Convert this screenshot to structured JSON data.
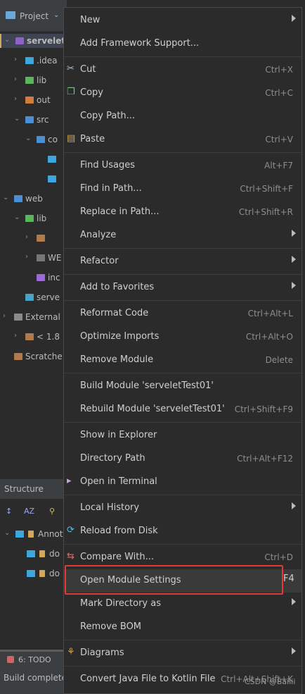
{
  "left_panel": {
    "title": "Project",
    "tree": [
      {
        "label": "servelet",
        "arrow": "▾",
        "bold": true
      },
      {
        "label": ".idea",
        "arrow": "›"
      },
      {
        "label": "lib",
        "arrow": "›"
      },
      {
        "label": "out",
        "arrow": "›"
      },
      {
        "label": "src",
        "arrow": "▾"
      },
      {
        "label": "co",
        "arrow": "▾"
      },
      {
        "label": "",
        "arrow": ""
      },
      {
        "label": "",
        "arrow": ""
      },
      {
        "label": "web",
        "arrow": "▾"
      },
      {
        "label": "lib",
        "arrow": "▾"
      },
      {
        "label": "",
        "arrow": "›"
      },
      {
        "label": "WE",
        "arrow": "›"
      },
      {
        "label": "inc",
        "arrow": ""
      },
      {
        "label": "serve",
        "arrow": ""
      },
      {
        "label": "External",
        "arrow": "›"
      },
      {
        "label": "< 1.8",
        "arrow": "›"
      },
      {
        "label": "Scratche",
        "arrow": ""
      }
    ],
    "structure_title": "Structure",
    "structure_items": [
      "Annot",
      "do",
      "do"
    ],
    "todo_label": "6: TODO",
    "status_text": "Build complete"
  },
  "context_menu": {
    "items": [
      {
        "label": "New",
        "submenu": true
      },
      {
        "label": "Add Framework Support..."
      },
      {
        "sep": true
      },
      {
        "label": "Cut",
        "shortcut": "Ctrl+X",
        "icon": "scissors-icon"
      },
      {
        "label": "Copy",
        "shortcut": "Ctrl+C",
        "icon": "copy-icon"
      },
      {
        "label": "Copy Path..."
      },
      {
        "label": "Paste",
        "shortcut": "Ctrl+V",
        "icon": "paste-icon"
      },
      {
        "sep": true
      },
      {
        "label": "Find Usages",
        "shortcut": "Alt+F7"
      },
      {
        "label": "Find in Path...",
        "shortcut": "Ctrl+Shift+F"
      },
      {
        "label": "Replace in Path...",
        "shortcut": "Ctrl+Shift+R"
      },
      {
        "label": "Analyze",
        "submenu": true
      },
      {
        "sep": true
      },
      {
        "label": "Refactor",
        "submenu": true
      },
      {
        "sep": true
      },
      {
        "label": "Add to Favorites",
        "submenu": true
      },
      {
        "sep": true
      },
      {
        "label": "Reformat Code",
        "shortcut": "Ctrl+Alt+L"
      },
      {
        "label": "Optimize Imports",
        "shortcut": "Ctrl+Alt+O"
      },
      {
        "label": "Remove Module",
        "shortcut": "Delete"
      },
      {
        "sep": true
      },
      {
        "label": "Build Module 'serveletTest01'"
      },
      {
        "label": "Rebuild Module 'serveletTest01'",
        "shortcut": "Ctrl+Shift+F9"
      },
      {
        "sep": true
      },
      {
        "label": "Show in Explorer"
      },
      {
        "label": "Directory Path",
        "shortcut": "Ctrl+Alt+F12"
      },
      {
        "label": "Open in Terminal",
        "icon": "terminal-icon"
      },
      {
        "sep": true
      },
      {
        "label": "Local History",
        "submenu": true
      },
      {
        "label": "Reload from Disk",
        "icon": "reload-icon"
      },
      {
        "sep": true
      },
      {
        "label": "Compare With...",
        "shortcut": "Ctrl+D",
        "icon": "compare-icon"
      },
      {
        "label": "Open Module Settings",
        "highlighted": true
      },
      {
        "label": "Mark Directory as",
        "submenu": true
      },
      {
        "label": "Remove BOM"
      },
      {
        "sep": true
      },
      {
        "label": "Diagrams",
        "submenu": true,
        "icon": "diagram-icon"
      },
      {
        "sep": true
      },
      {
        "label": "Convert Java File to Kotlin File",
        "shortcut": "Ctrl+Alt+Shift+K"
      }
    ],
    "open_module_settings_shortcut": "F4"
  },
  "watermark": "CSDN @Bailii",
  "colors": {
    "highlight_box": "#e53935",
    "background": "#2b2b2b",
    "text": "#cfcfcf",
    "shortcut": "#8e8e8e"
  }
}
